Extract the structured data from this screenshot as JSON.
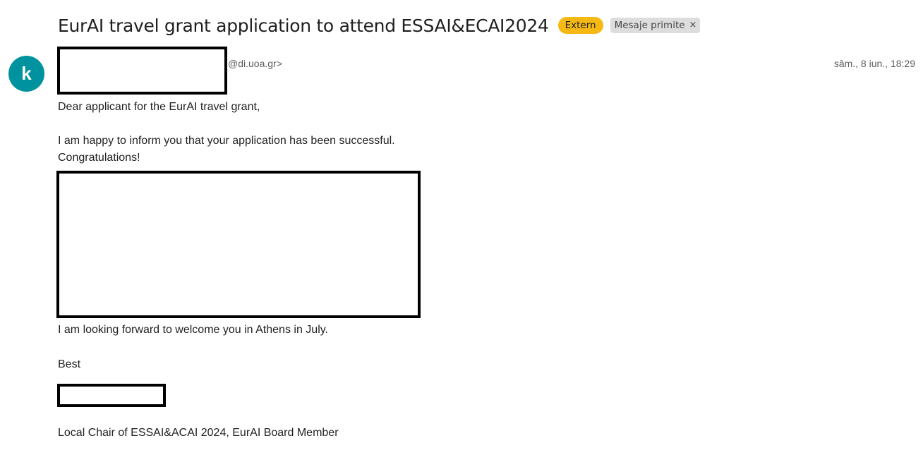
{
  "email": {
    "subject": "EurAI travel grant application to attend ESSAI&ECAI2024",
    "labels": {
      "extern": "Extern",
      "inbox": "Mesaje primite",
      "remove_symbol": "×"
    },
    "sender": {
      "avatar_letter": "k",
      "avatar_color": "#00939f",
      "domain": "@di.uoa.gr>"
    },
    "date": "sâm., 8 iun., 18:29",
    "body": {
      "greeting": "Dear applicant for the EurAI travel grant,",
      "line1": "I am happy to inform you that your application has been successful.",
      "line2": "Congratulations!",
      "line3": "I am looking forward to welcome you in Athens in July.",
      "closing": "Best",
      "signature_title": "Local Chair of ESSAI&ACAI 2024, EurAI Board Member"
    }
  },
  "colors": {
    "extern_chip": "#f6b913",
    "label_chip": "#dddddd",
    "redaction_border": "#000000"
  }
}
